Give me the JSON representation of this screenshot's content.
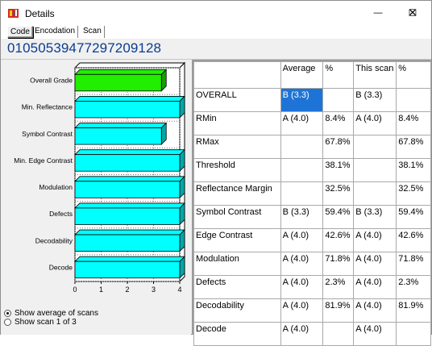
{
  "window": {
    "title": "Details",
    "minimize_glyph": "—",
    "maximize_glyph": "☐",
    "close_glyph": "✕"
  },
  "tabs": [
    {
      "label": "Code",
      "active": true
    },
    {
      "label": "Encodation",
      "active": false
    },
    {
      "label": "Scan",
      "active": false
    }
  ],
  "code_value": "01050539477297209128",
  "chart_data": {
    "type": "bar",
    "orientation": "horizontal",
    "categories": [
      "Overall Grade",
      "Min. Reflectance",
      "Symbol Contrast",
      "Min. Edge Contrast",
      "Modulation",
      "Defects",
      "Decodability",
      "Decode"
    ],
    "values": [
      3.3,
      4.0,
      3.3,
      4.0,
      4.0,
      4.0,
      4.0,
      4.0
    ],
    "colors": [
      "#22ee00",
      "#00ffff",
      "#00ffff",
      "#00ffff",
      "#00ffff",
      "#00ffff",
      "#00ffff",
      "#00ffff"
    ],
    "xlim": [
      0,
      4
    ],
    "xticks": [
      "0",
      "1",
      "2",
      "3",
      "4"
    ],
    "grid": true,
    "style": "3d"
  },
  "options": {
    "show_average": "Show average of scans",
    "show_scan": "Show scan 1 of 3",
    "selected": "average"
  },
  "table": {
    "headers": [
      "",
      "Average",
      "%",
      "This scan",
      "%"
    ],
    "rows": [
      {
        "name": "OVERALL",
        "avg": "B (3.3)",
        "avg_pct": "",
        "scan": "B (3.3)",
        "scan_pct": "",
        "selected": true
      },
      {
        "name": "RMin",
        "avg": "A (4.0)",
        "avg_pct": "8.4%",
        "scan": "A (4.0)",
        "scan_pct": "8.4%"
      },
      {
        "name": "RMax",
        "avg": "",
        "avg_pct": "67.8%",
        "scan": "",
        "scan_pct": "67.8%"
      },
      {
        "name": "Threshold",
        "avg": "",
        "avg_pct": "38.1%",
        "scan": "",
        "scan_pct": "38.1%"
      },
      {
        "name": "Reflectance Margin",
        "avg": "",
        "avg_pct": "32.5%",
        "scan": "",
        "scan_pct": "32.5%"
      },
      {
        "name": "Symbol Contrast",
        "avg": "B (3.3)",
        "avg_pct": "59.4%",
        "scan": "B (3.3)",
        "scan_pct": "59.4%"
      },
      {
        "name": "Edge Contrast",
        "avg": "A (4.0)",
        "avg_pct": "42.6%",
        "scan": "A (4.0)",
        "scan_pct": "42.6%"
      },
      {
        "name": "Modulation",
        "avg": "A (4.0)",
        "avg_pct": "71.8%",
        "scan": "A (4.0)",
        "scan_pct": "71.8%"
      },
      {
        "name": "Defects",
        "avg": "A (4.0)",
        "avg_pct": "2.3%",
        "scan": "A (4.0)",
        "scan_pct": "2.3%"
      },
      {
        "name": "Decodability",
        "avg": "A (4.0)",
        "avg_pct": "81.9%",
        "scan": "A (4.0)",
        "scan_pct": "81.9%"
      },
      {
        "name": "Decode",
        "avg": "A (4.0)",
        "avg_pct": "",
        "scan": "A (4.0)",
        "scan_pct": ""
      }
    ]
  }
}
